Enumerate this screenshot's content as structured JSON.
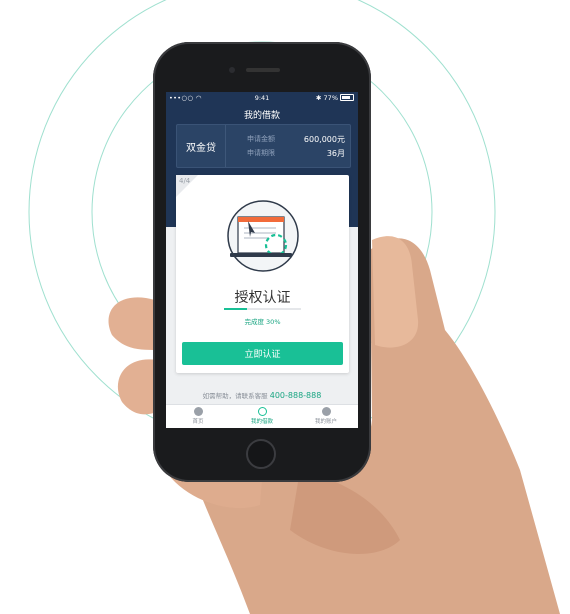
{
  "status_bar": {
    "carrier": "•••○○ ◠",
    "time": "9:41",
    "battery": "✱ 77%"
  },
  "header": {
    "title": "我的借款"
  },
  "loan": {
    "product": "双金贷",
    "amount_label": "申请金额",
    "amount_value": "600,000元",
    "term_label": "申请期限",
    "term_value": "36月"
  },
  "step_card": {
    "step": "4/4",
    "title": "授权认证",
    "progress_text": "完成度 30%",
    "progress": 0.3,
    "button_label": "立即认证"
  },
  "help": {
    "text": "如需帮助，请联系客服",
    "phone": "400-888-888"
  },
  "tabs": [
    {
      "label": "首页",
      "icon": "home-icon",
      "active": false
    },
    {
      "label": "我的借款",
      "icon": "list-icon",
      "active": true
    },
    {
      "label": "我的账户",
      "icon": "user-icon",
      "active": false
    }
  ],
  "colors": {
    "accent": "#19c096",
    "header": "#1f3556",
    "ring": "#8fdcc6"
  }
}
